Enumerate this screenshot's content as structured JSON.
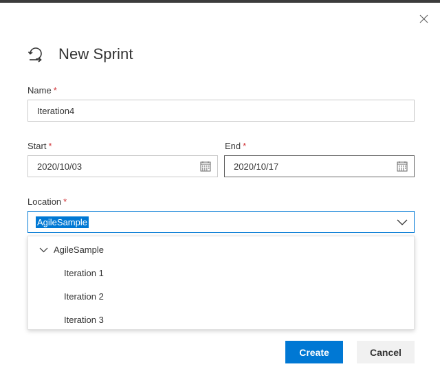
{
  "dialog": {
    "title": "New Sprint",
    "close_icon": "close-icon",
    "title_icon": "sprint-cycle-icon"
  },
  "form": {
    "name": {
      "label": "Name",
      "required": "*",
      "value": "Iteration4"
    },
    "start": {
      "label": "Start",
      "required": "*",
      "value": "2020/10/03",
      "icon": "calendar-icon"
    },
    "end": {
      "label": "End",
      "required": "*",
      "value": "2020/10/17",
      "icon": "calendar-icon"
    },
    "location": {
      "label": "Location",
      "required": "*",
      "value": "AgileSample",
      "icon": "chevron-down-icon"
    }
  },
  "dropdown": {
    "root": "AgileSample",
    "items": [
      "Iteration 1",
      "Iteration 2",
      "Iteration 3"
    ]
  },
  "buttons": {
    "create": "Create",
    "cancel": "Cancel"
  },
  "colors": {
    "accent": "#0078d4",
    "required": "#d13438"
  }
}
